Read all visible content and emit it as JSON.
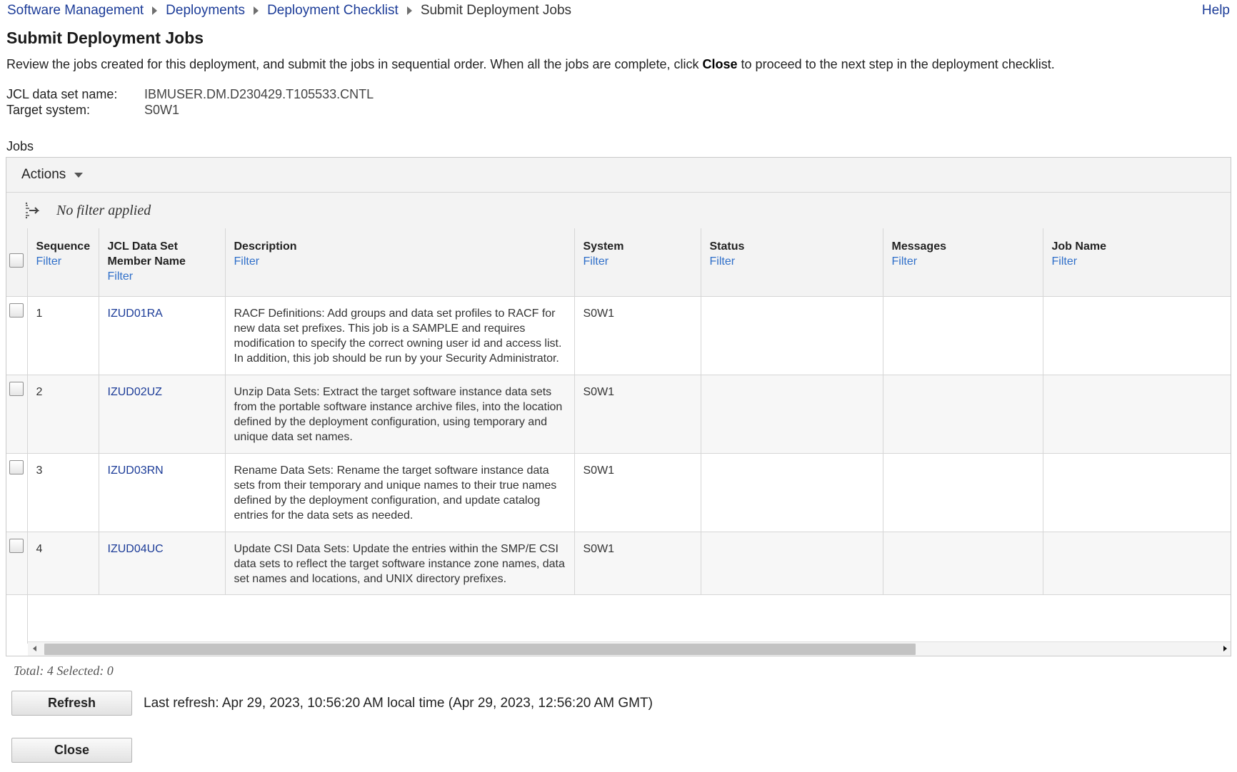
{
  "breadcrumb": {
    "items": [
      "Software Management",
      "Deployments",
      "Deployment Checklist"
    ],
    "current": "Submit Deployment Jobs"
  },
  "help_label": "Help",
  "page_title": "Submit Deployment Jobs",
  "intro": {
    "before": "Review the jobs created for this deployment, and submit the jobs in sequential order. When all the jobs are complete, click ",
    "bold": "Close",
    "after": " to proceed to the next step in the deployment checklist."
  },
  "info": {
    "jcl_label": "JCL data set name:",
    "jcl_value": "IBMUSER.DM.D230429.T105533.CNTL",
    "target_label": "Target system:",
    "target_value": "S0W1"
  },
  "jobs_label": "Jobs",
  "grid": {
    "actions_label": "Actions",
    "filter_status": "No filter applied",
    "filter_link": "Filter",
    "columns": [
      "Sequence",
      "JCL Data Set Member Name",
      "Description",
      "System",
      "Status",
      "Messages",
      "Job Name"
    ],
    "rows": [
      {
        "sequence": "1",
        "member": "IZUD01RA",
        "description": "RACF Definitions: Add groups and data set profiles to RACF for new data set prefixes. This job is a SAMPLE and requires modification to specify the correct owning user id and access list. In addition, this job should be run by your Security Administrator.",
        "system": "S0W1",
        "status": "",
        "messages": "",
        "job_name": ""
      },
      {
        "sequence": "2",
        "member": "IZUD02UZ",
        "description": "Unzip Data Sets: Extract the target software instance data sets from the portable software instance archive files, into the location defined by the deployment configuration, using temporary and unique data set names.",
        "system": "S0W1",
        "status": "",
        "messages": "",
        "job_name": ""
      },
      {
        "sequence": "3",
        "member": "IZUD03RN",
        "description": "Rename Data Sets: Rename the target software instance data sets from their temporary and unique names to their true names defined by the deployment configuration, and update catalog entries for the data sets as needed.",
        "system": "S0W1",
        "status": "",
        "messages": "",
        "job_name": ""
      },
      {
        "sequence": "4",
        "member": "IZUD04UC",
        "description": "Update CSI Data Sets: Update the entries within the SMP/E CSI data sets to reflect the target software instance zone names, data set names and locations, and UNIX directory prefixes.",
        "system": "S0W1",
        "status": "",
        "messages": "",
        "job_name": ""
      }
    ]
  },
  "totals": "Total: 4 Selected: 0",
  "refresh_label": "Refresh",
  "last_refresh": "Last refresh: Apr 29, 2023, 10:56:20 AM local time (Apr 29, 2023, 12:56:20 AM GMT)",
  "close_label": "Close",
  "colors": {
    "link": "#1c3c98",
    "filter_link": "#2f6fc9",
    "header_bg": "#f3f3f3",
    "scroll_thumb": "#c3c3c3"
  },
  "icons": {
    "breadcrumb_separator": "caret-right-icon",
    "actions": "caret-down-icon",
    "filter": "filter-arrows-icon"
  }
}
